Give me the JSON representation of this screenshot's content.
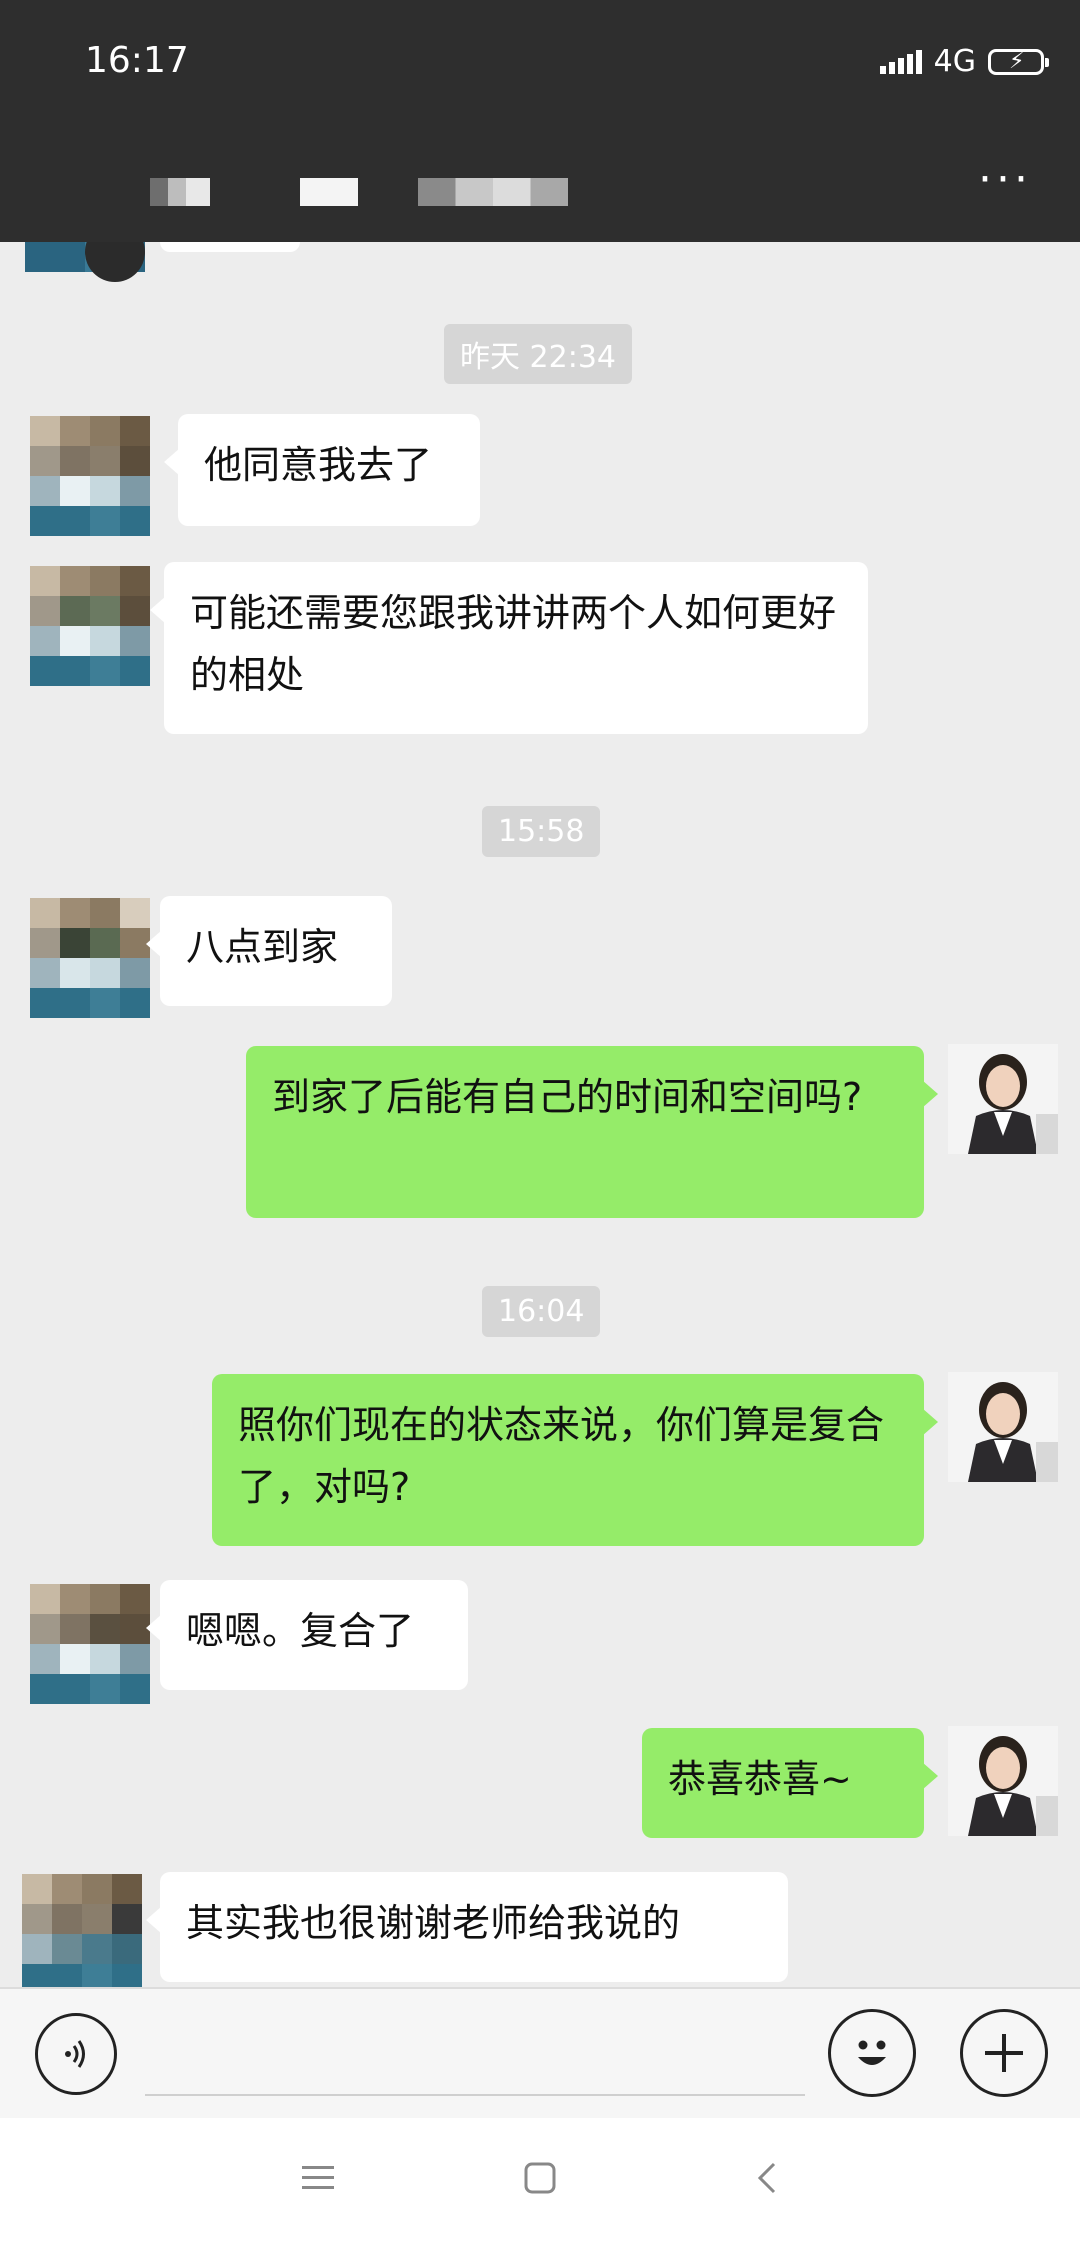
{
  "status_bar": {
    "time": "16:17",
    "network": "4G"
  },
  "title_bar": {
    "more_icon": "more-dots-icon"
  },
  "messages": [
    {
      "type": "time",
      "text": "昨天 22:34"
    },
    {
      "type": "in",
      "text": "他同意我去了"
    },
    {
      "type": "in",
      "text": "可能还需要您跟我讲讲两个人如何更好的相处"
    },
    {
      "type": "time",
      "text": "15:58"
    },
    {
      "type": "in",
      "text": "八点到家"
    },
    {
      "type": "out",
      "text": "到家了后能有自己的时间和空间吗?"
    },
    {
      "type": "time",
      "text": "16:04"
    },
    {
      "type": "out",
      "text": "照你们现在的状态来说，你们算是复合了，对吗?"
    },
    {
      "type": "in",
      "text": "嗯嗯。复合了"
    },
    {
      "type": "out",
      "text": "恭喜恭喜~"
    },
    {
      "type": "in",
      "text": "其实我也很谢谢老师给我说的"
    }
  ],
  "input_bar": {
    "voice_icon": "voice-icon",
    "emoji_icon": "emoji-icon",
    "plus_icon": "plus-icon"
  },
  "nav_bar": {
    "menu_icon": "menu-icon",
    "home_icon": "home-icon",
    "back_icon": "back-icon"
  },
  "colors": {
    "header": "#2e2e2e",
    "chat_bg": "#ededed",
    "out_bubble": "#95ec69",
    "in_bubble": "#ffffff"
  }
}
